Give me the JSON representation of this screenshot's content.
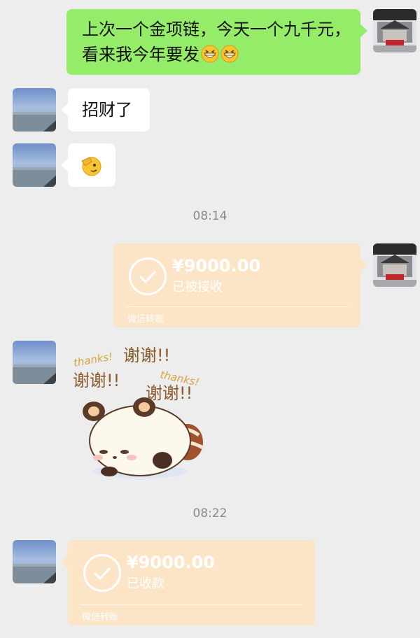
{
  "messages": {
    "m1": {
      "text": "上次一个金项链，今天一个九千元，看来我今年要发",
      "emojis": [
        "grin-emoji",
        "grin-emoji"
      ]
    },
    "m2": {
      "text": "招财了"
    },
    "m3": {
      "emoji": "salute-emoji"
    },
    "time1": "08:14",
    "transfer1": {
      "amount": "¥9000.00",
      "status": "已被接收",
      "footer": "微信转账"
    },
    "sticker": {
      "texts": [
        "thanks!",
        "谢谢!!",
        "谢谢!!",
        "thanks!",
        "谢谢!!"
      ]
    },
    "time2": "08:22",
    "transfer2": {
      "amount": "¥9000.00",
      "status": "已收款",
      "footer": "微信转账"
    }
  },
  "colors": {
    "background": "#ededed",
    "self_bubble": "#95ec69",
    "other_bubble": "#ffffff",
    "transfer_card": "#fce4c7",
    "timestamp": "#8a8a8a"
  }
}
